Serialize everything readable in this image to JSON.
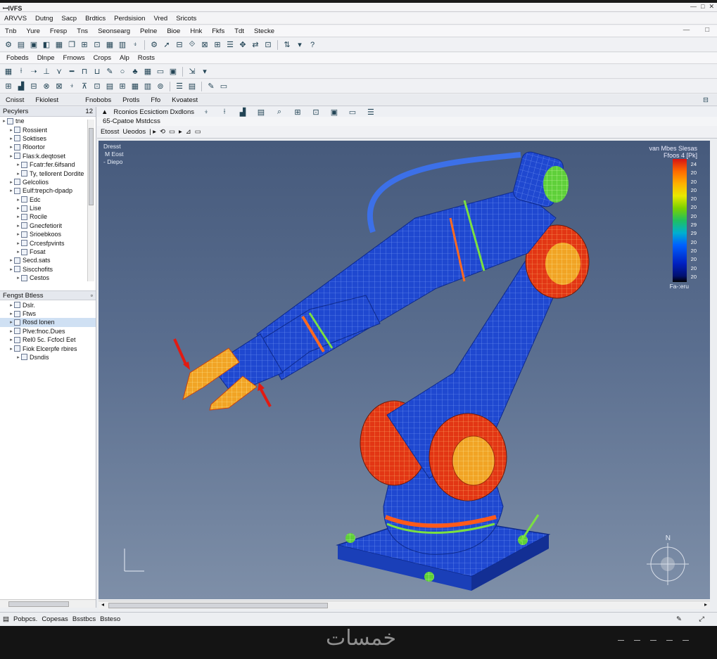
{
  "window": {
    "title": "ꟷIVFS",
    "controls": [
      "—",
      "□",
      "✕"
    ]
  },
  "menu1": [
    "ARVVS",
    "Dutng",
    "Sacp",
    "Brdtics",
    "Perdsision",
    "Vred",
    "Sricots"
  ],
  "menu2": [
    "Tnb",
    "Yure",
    "Fresp",
    "Tns",
    "Seonsearg",
    "Pelne",
    "Bioe",
    "Hnk",
    "Fkfs",
    "Tdt",
    "Stecke"
  ],
  "menu2_right": [
    "—",
    "□"
  ],
  "toolbar3": [
    "Fobeds",
    "Dlnpe",
    "Frnows",
    "Crops",
    "Alp",
    "Rosts"
  ],
  "tabs": [
    "Cnisst",
    "Fkiolest",
    "Fnobobs",
    "Protls",
    "Ffo",
    "Kvoatest"
  ],
  "left_panel": {
    "header": "Pecylers",
    "header_right": "12",
    "tree": [
      {
        "label": "tne",
        "level": 0
      },
      {
        "label": "Rossient",
        "level": 1
      },
      {
        "label": "Soktises",
        "level": 1
      },
      {
        "label": "Rloortor",
        "level": 1
      },
      {
        "label": "Flas:k.deqtoset",
        "level": 1
      },
      {
        "label": "Fcatr:fer.6ifsand",
        "level": 2
      },
      {
        "label": "Ty, tellorent Dordite",
        "level": 2
      },
      {
        "label": "Gelcolios",
        "level": 1
      },
      {
        "label": "Eulf:trepch-dpadp",
        "level": 1
      },
      {
        "label": "Edc",
        "level": 2
      },
      {
        "label": "Lise",
        "level": 2
      },
      {
        "label": "Rocile",
        "level": 2
      },
      {
        "label": "Gnecfetiorit",
        "level": 2
      },
      {
        "label": "Srioebkoos",
        "level": 2
      },
      {
        "label": "Crcesfpvints",
        "level": 2
      },
      {
        "label": "Fosat",
        "level": 2
      },
      {
        "label": "Secd.sats",
        "level": 1
      },
      {
        "label": "Siscchofits",
        "level": 1
      },
      {
        "label": "Cestos",
        "level": 2
      }
    ],
    "header2": "Fengst Btless",
    "tree2": [
      {
        "label": "Dslr.",
        "level": 1
      },
      {
        "label": "Ftws",
        "level": 1
      },
      {
        "label": "Rosd lonen",
        "level": 1,
        "selected": true
      },
      {
        "label": "Plve:fnoc.Dues",
        "level": 1
      },
      {
        "label": "Rel0 5c. Fcfocl Eet",
        "level": 1
      },
      {
        "label": "Fiok Elcerpfe rbires",
        "level": 1
      },
      {
        "label": "Dsndis",
        "level": 2
      }
    ]
  },
  "main": {
    "header": "Rconios Ecsictiom Dxdlons",
    "subheader": "65-Cpatoe  Mstdcss",
    "toolbar": [
      "Etosst",
      "Ueodos"
    ],
    "vp_labels": [
      "Dresst",
      "M Eost",
      "- Diepo"
    ],
    "legend_title": "van Mbes Slesas",
    "legend_units": "Ffoos 4 [Pk]",
    "legend_values": [
      "24",
      "20",
      "20",
      "20",
      "20",
      "20",
      "20",
      "29",
      "29",
      "20",
      "20",
      "20",
      "20",
      "20"
    ],
    "legend_bottom": "Fa-:eru",
    "compass": "N"
  },
  "status": [
    "Pobpcs.",
    "Copesas",
    "Bsstbcs",
    "Bsteso"
  ],
  "watermark": "خمسات",
  "colors": {
    "accent": "#1f4fd6",
    "hot": "#e52313",
    "warm": "#f7a31a",
    "mesh": "#1b3fc0"
  }
}
